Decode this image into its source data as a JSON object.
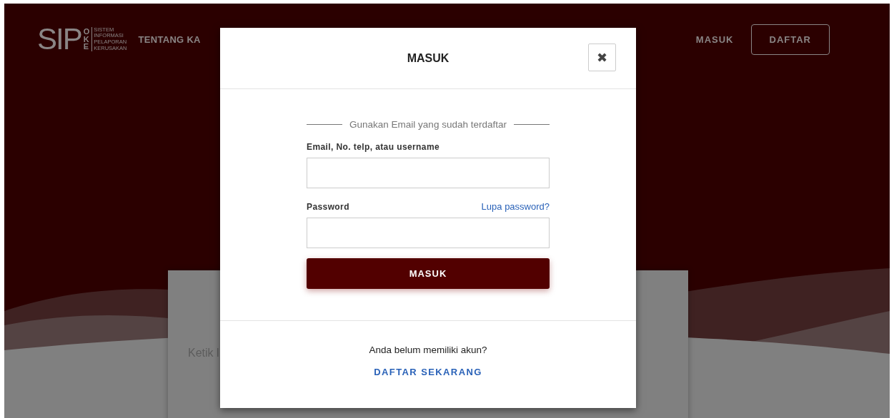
{
  "header": {
    "logo": {
      "mark": "SIP",
      "stack": "OKE",
      "lines": [
        "SISTEM",
        "INFORMASI",
        "PELAPORAN",
        "KERUSAKAN"
      ]
    },
    "nav": [
      {
        "label": "TENTANG KA"
      }
    ],
    "actions": [
      {
        "label": "MASUK",
        "kind": "link"
      },
      {
        "label": "DAFTAR",
        "kind": "outline"
      }
    ]
  },
  "search_card": {
    "text": "Ketik l"
  },
  "modal": {
    "title": "MASUK",
    "close": "✖",
    "divider_text": "Gunakan Email yang sudah terdaftar",
    "fields": [
      {
        "label": "Email, No. telp, atau username"
      },
      {
        "label": "Password",
        "link": "Lupa password?"
      }
    ],
    "submit": "MASUK",
    "footer_text": "Anda belum memiliki akun?",
    "footer_link": "DAFTAR SEKARANG"
  }
}
